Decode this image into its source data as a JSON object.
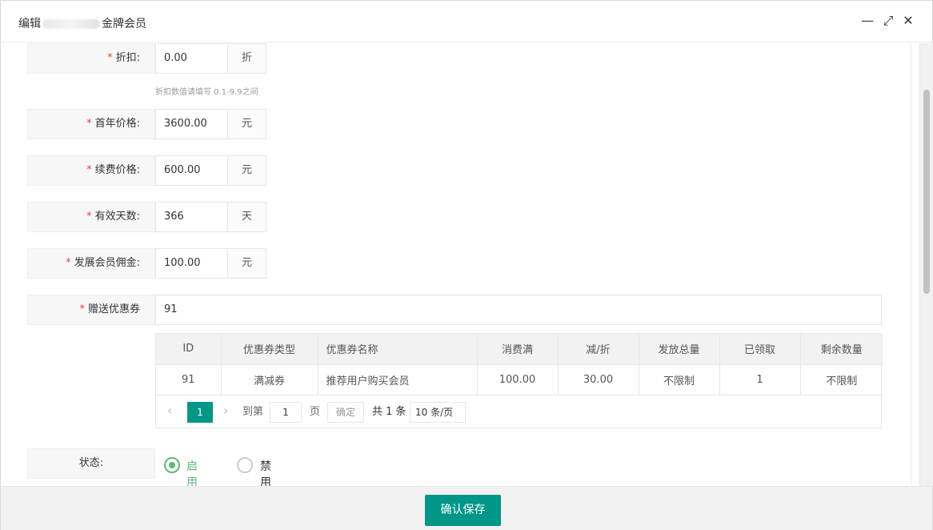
{
  "dialog": {
    "title_prefix": "编辑",
    "title_suffix": "金牌会员",
    "minimize_label": "—",
    "maximize_label": "⤢",
    "close_label": "✕"
  },
  "form": {
    "required_mark": "*",
    "discount": {
      "label": "折扣:",
      "value": "0.00",
      "suffix": "折",
      "hint": "折扣数值请填写 0.1-9.9之间"
    },
    "first_year_price": {
      "label": "首年价格:",
      "value": "3600.00",
      "suffix": "元"
    },
    "renewal_price": {
      "label": "续费价格:",
      "value": "600.00",
      "suffix": "元"
    },
    "valid_days": {
      "label": "有效天数:",
      "value": "366",
      "suffix": "天"
    },
    "commission": {
      "label": "发展会员佣金:",
      "value": "100.00",
      "suffix": "元"
    },
    "coupon": {
      "label": "赠送优惠券",
      "value": "91"
    },
    "status": {
      "label": "状态:",
      "options": [
        "启用",
        "禁用"
      ],
      "selected": "启用"
    }
  },
  "coupon_table": {
    "headers": [
      "ID",
      "优惠券类型",
      "优惠券名称",
      "消费满",
      "减/折",
      "发放总量",
      "已领取",
      "剩余数量"
    ],
    "rows": [
      [
        "91",
        "满减券",
        "推荐用户购买会员",
        "100.00",
        "30.00",
        "不限制",
        "1",
        "不限制"
      ]
    ]
  },
  "pager": {
    "current_page": "1",
    "goto_label": "到第",
    "goto_value": "1",
    "page_unit": "页",
    "confirm_label": "确定",
    "total_label": "共 1 条",
    "page_size": "10 条/页"
  },
  "footer": {
    "save_label": "确认保存"
  },
  "colors": {
    "primary": "#009688",
    "radio_active": "#5fb878",
    "required": "#e64545"
  }
}
